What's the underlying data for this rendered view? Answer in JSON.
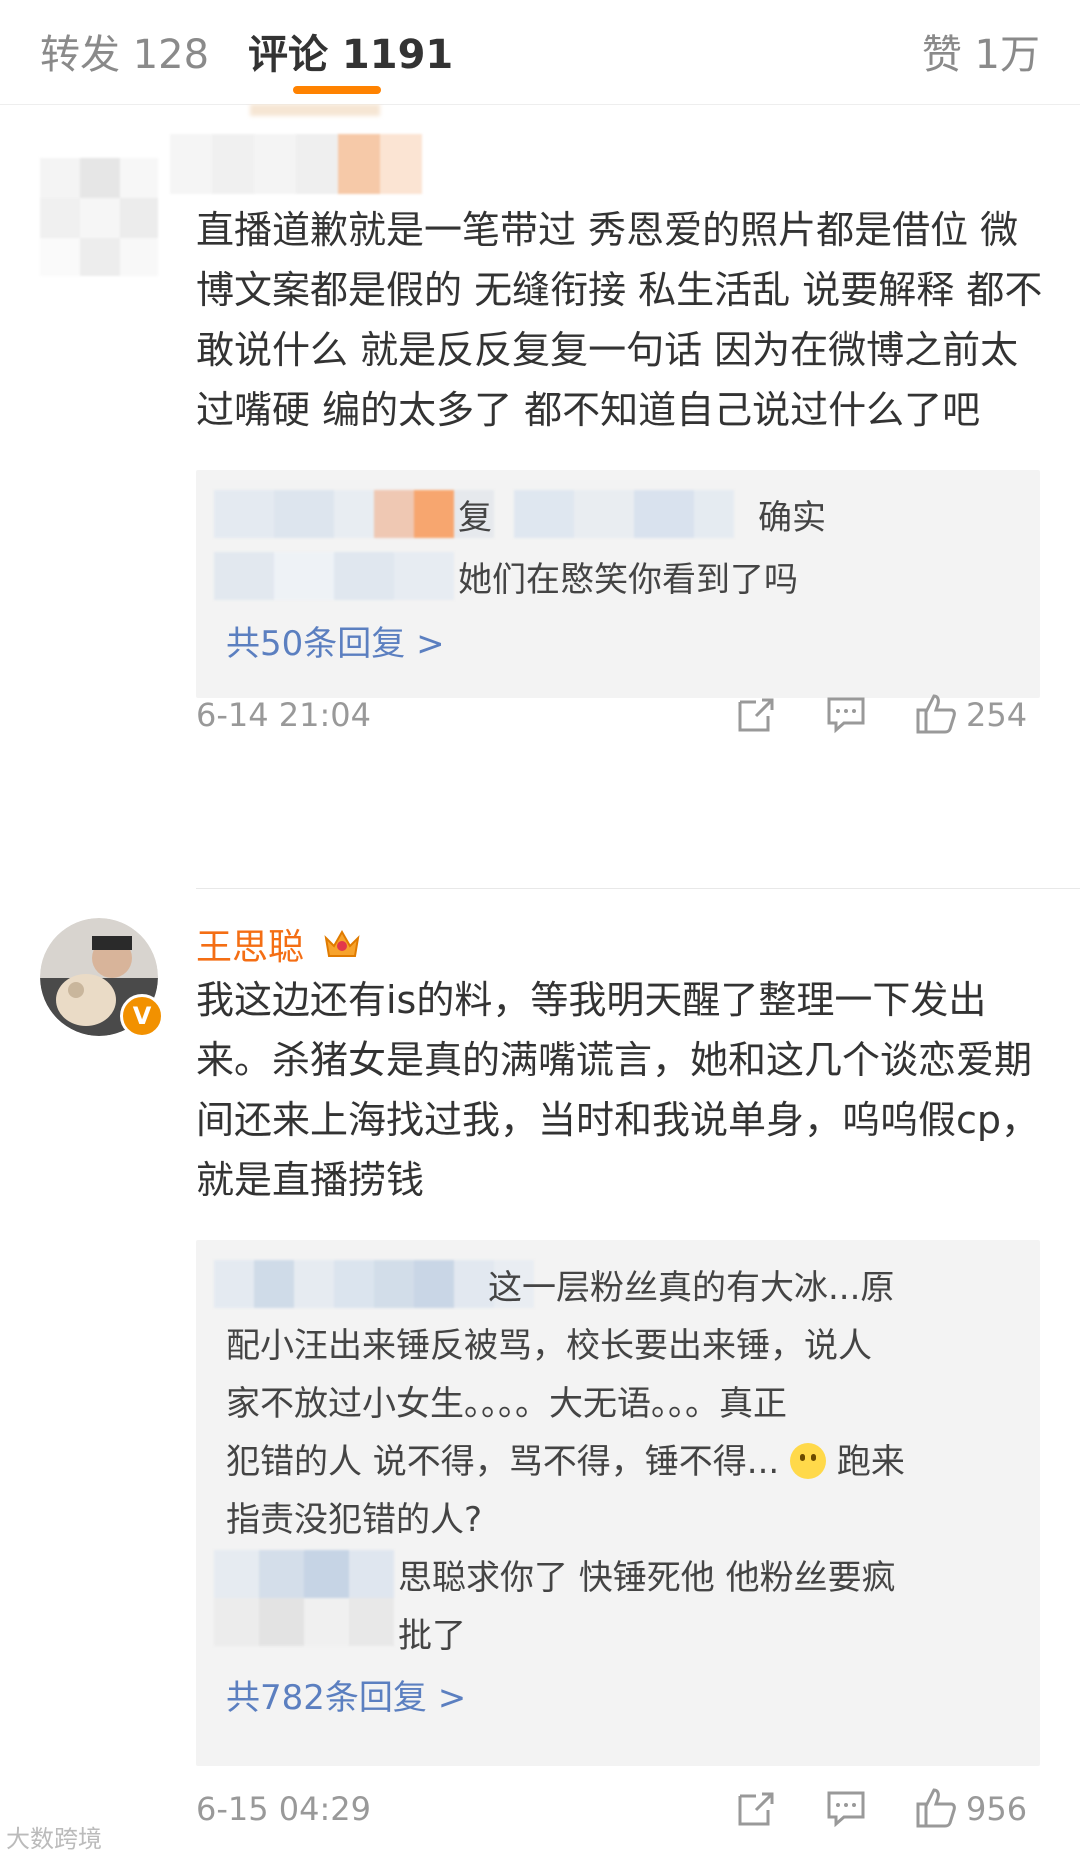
{
  "tabs": {
    "repost": "转发 128",
    "comments": "评论 1191",
    "likes": "赞 1万",
    "accent": "#ff8200"
  },
  "comments": [
    {
      "user": "",
      "body": "直播道歉就是一笔带过 秀恩爱的照片都是借位 微博文案都是假的 无缝衔接 私生活乱 说要解释 都不敢说什么 就是反反复复一句话 因为在微博之前太过嘴硬 编的太多了 都不知道自己说过什么了吧",
      "replies": [
        "复",
        "确实",
        "她们在愍笑你看到了吗"
      ],
      "more": "共50条回复 >",
      "time": "6-14 21:04",
      "likes": "254"
    },
    {
      "user": "王思聪",
      "verified": "V",
      "body": "我这边还有is的料，等我明天醒了整理一下发出来。杀猪女是真的满嘴谎言，她和这几个谈恋爱期间还来上海找过我，当时和我说单身，呜呜假cp，就是直播捞钱",
      "replies": [
        "这一层粉丝真的有大冰...原",
        "配小汪出来锤反被骂，校长要出来锤，说人",
        "家不放过小女生。。。。大无语。。。真正",
        "犯错的人 说不得，骂不得，锤不得...",
        "跑来",
        "指责没犯错的人?",
        "思聪求你了 快锤死他 他粉丝要疯",
        "批了"
      ],
      "more": "共782条回复 >",
      "time": "6-15 04:29",
      "likes": "956"
    }
  ],
  "icons": [
    "repost-icon",
    "comment-icon",
    "like-icon",
    "crown-icon",
    "smile-emoji-icon"
  ],
  "watermark": "大数跨境"
}
